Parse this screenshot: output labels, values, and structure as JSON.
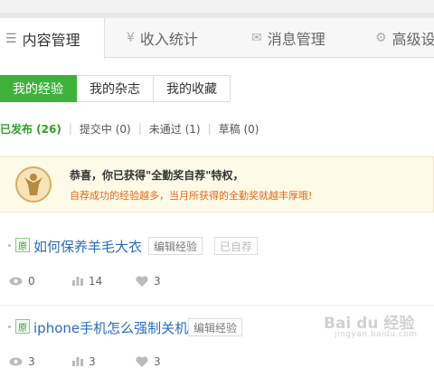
{
  "nav": {
    "tabs": [
      {
        "label": "内容管理",
        "icon": "list-icon"
      },
      {
        "label": "收入统计",
        "icon": "yen-icon"
      },
      {
        "label": "消息管理",
        "icon": "mail-icon"
      },
      {
        "label": "高级设",
        "icon": "gear-icon"
      }
    ]
  },
  "subtabs": [
    "我的经验",
    "我的杂志",
    "我的收藏"
  ],
  "filters": [
    {
      "label": "已发布 (26)"
    },
    {
      "label": "提交中 (0)"
    },
    {
      "label": "未通过 (1)"
    },
    {
      "label": "草稿 (0)"
    }
  ],
  "notice": {
    "title": "恭喜，你已获得\"全勤奖自荐\"特权，",
    "body": "自荐成功的经验越多，当月所获得的全勤奖就越丰厚哦!"
  },
  "items": [
    {
      "badge": "原",
      "title": "如何保养羊毛大衣",
      "edit_label": "编辑经验",
      "recommend_label": "已自荐",
      "views": "0",
      "votes": "14",
      "likes": "3"
    },
    {
      "badge": "原",
      "title": "iphone手机怎么强制关机",
      "edit_label": "编辑经验",
      "views": "3",
      "votes": "3",
      "likes": "3"
    }
  ],
  "watermark": {
    "text": "Bai du 经验",
    "sub": "jingyan.baidu.com"
  },
  "colors": {
    "accent": "#3eb13b",
    "link": "#2a6db5",
    "notice_text": "#e06a1a"
  }
}
